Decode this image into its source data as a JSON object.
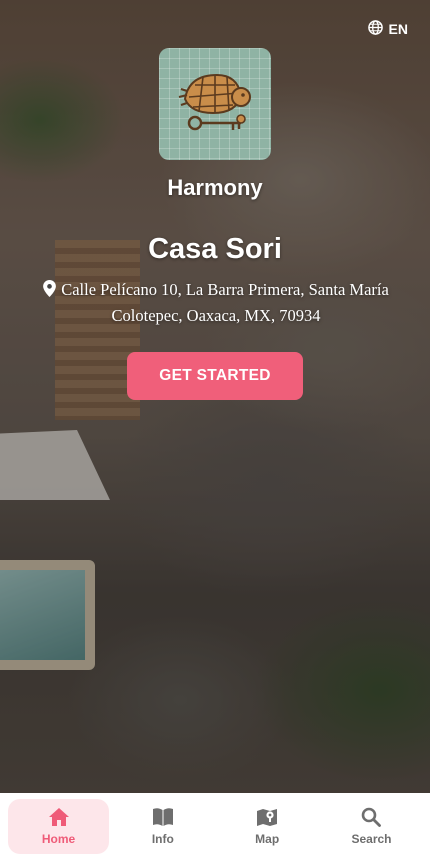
{
  "language": {
    "label": "EN",
    "icon": "globe-icon"
  },
  "brand": {
    "name": "Harmony",
    "logo": "turtle-key-logo"
  },
  "property": {
    "name": "Casa Sori",
    "address": "Calle Pelícano 10, La Barra Primera, Santa María Colotepec, Oaxaca, MX, 70934",
    "address_icon": "map-pin-icon"
  },
  "cta": {
    "label": "GET STARTED"
  },
  "nav": {
    "items": [
      {
        "label": "Home",
        "icon": "home-icon",
        "active": true
      },
      {
        "label": "Info",
        "icon": "book-icon",
        "active": false
      },
      {
        "label": "Map",
        "icon": "map-icon",
        "active": false
      },
      {
        "label": "Search",
        "icon": "search-icon",
        "active": false
      }
    ]
  },
  "colors": {
    "accent": "#f05f7a",
    "tab_active_bg": "#fde6ea",
    "logo_bg": "#8fb3a4"
  }
}
